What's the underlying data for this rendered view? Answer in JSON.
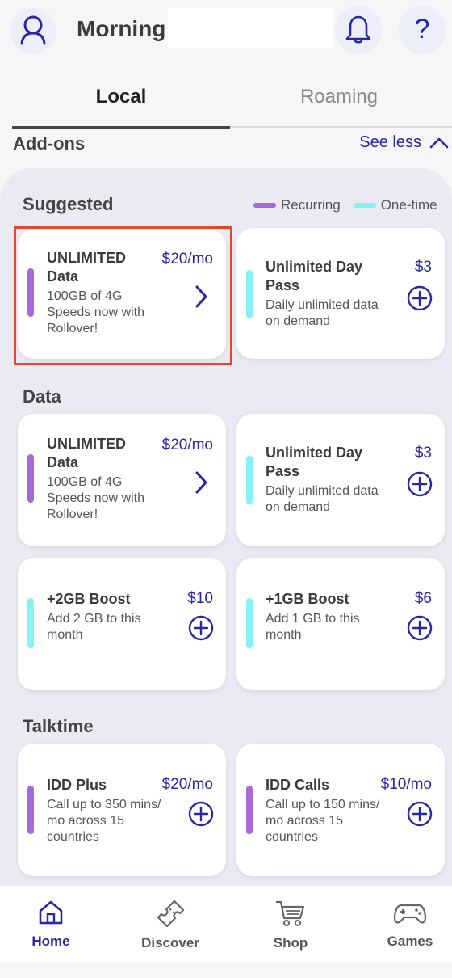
{
  "header": {
    "greeting": "Morning",
    "icons": {
      "profile": "person-icon",
      "notifications": "bell-icon",
      "help": "question-icon"
    },
    "help_glyph": "?"
  },
  "tabs": [
    {
      "label": "Local",
      "active": true
    },
    {
      "label": "Roaming",
      "active": false
    }
  ],
  "addons": {
    "title": "Add-ons",
    "toggle_label": "See less"
  },
  "legend": {
    "recurring": "Recurring",
    "one_time": "One-time"
  },
  "colors": {
    "accent": "#2727a8",
    "recurring": "#a66ad9",
    "one_time": "#86f2f3",
    "highlight": "#e2472f"
  },
  "suggested": {
    "title": "Suggested",
    "cards": [
      {
        "title_l1": "UNLIMITED",
        "title_l2": "Data",
        "desc_l1": "100GB of 4G",
        "desc_l2": "Speeds now with",
        "desc_l3": "Rollover!",
        "price": "$20/mo",
        "type": "recurring",
        "action": "chevron-right-icon"
      },
      {
        "title_l1": "Unlimited Day",
        "title_l2": "Pass",
        "desc_l1": "Daily unlimited data",
        "desc_l2": "on demand",
        "price": "$3",
        "type": "one-time",
        "action": "plus-circle-icon"
      }
    ]
  },
  "data": {
    "title": "Data",
    "cards": [
      {
        "title_l1": "UNLIMITED",
        "title_l2": "Data",
        "desc_l1": "100GB of 4G",
        "desc_l2": "Speeds now with",
        "desc_l3": "Rollover!",
        "price": "$20/mo",
        "type": "recurring",
        "action": "chevron-right-icon"
      },
      {
        "title_l1": "Unlimited Day",
        "title_l2": "Pass",
        "desc_l1": "Daily unlimited data",
        "desc_l2": "on demand",
        "price": "$3",
        "type": "one-time",
        "action": "plus-circle-icon"
      },
      {
        "title_l1": "+2GB Boost",
        "desc_l1": "Add 2 GB to this",
        "desc_l2": "month",
        "price": "$10",
        "type": "one-time",
        "action": "plus-circle-icon"
      },
      {
        "title_l1": "+1GB Boost",
        "desc_l1": "Add 1 GB to this",
        "desc_l2": "month",
        "price": "$6",
        "type": "one-time",
        "action": "plus-circle-icon"
      }
    ]
  },
  "talktime": {
    "title": "Talktime",
    "cards": [
      {
        "title_l1": "IDD Plus",
        "desc_l1": "Call up to 350 mins/",
        "desc_l2": "mo across 15",
        "desc_l3": "countries",
        "price": "$20/mo",
        "type": "recurring",
        "action": "plus-circle-icon"
      },
      {
        "title_l1": "IDD Calls",
        "desc_l1": "Call up to 150 mins/",
        "desc_l2": "mo across 15",
        "desc_l3": "countries",
        "price": "$10/mo",
        "type": "recurring",
        "action": "plus-circle-icon"
      }
    ]
  },
  "bottom_nav": [
    {
      "label": "Home",
      "icon": "home-icon",
      "active": true
    },
    {
      "label": "Discover",
      "icon": "ticket-icon",
      "active": false
    },
    {
      "label": "Shop",
      "icon": "cart-icon",
      "active": false
    },
    {
      "label": "Games",
      "icon": "gamepad-icon",
      "active": false
    }
  ]
}
